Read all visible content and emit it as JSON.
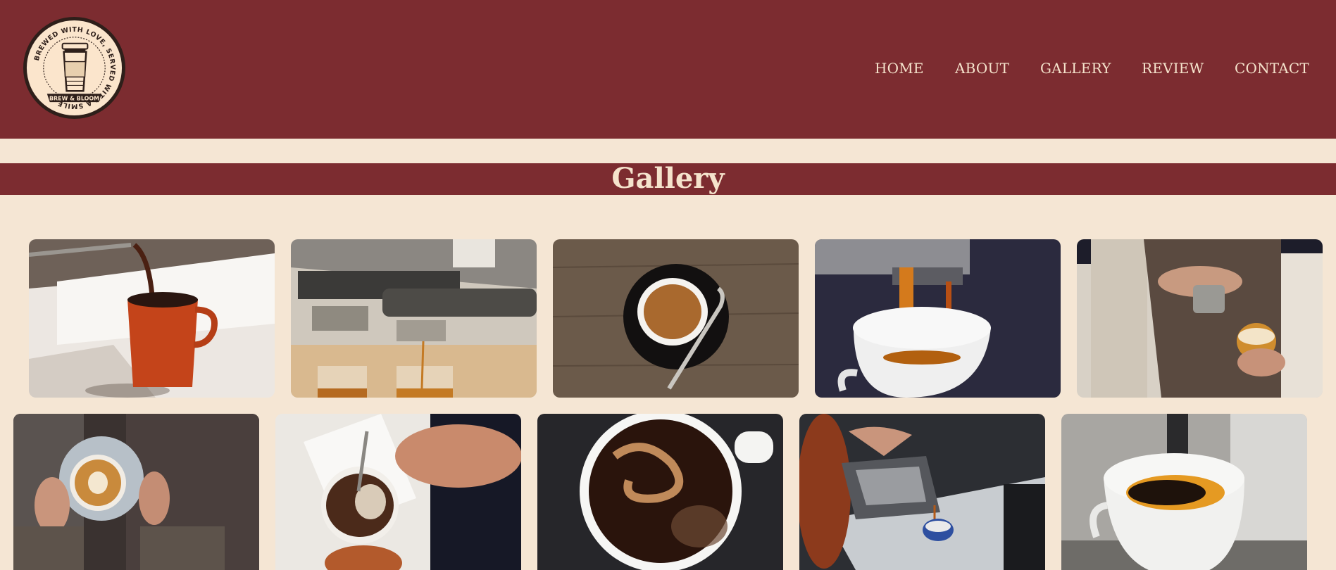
{
  "header": {
    "logo": {
      "ring_text": "BREWED WITH LOVE, SERVED WITH A SMILE",
      "banner_text": "BREW & BLOOM",
      "icon": "coffee-cup-icon"
    },
    "nav": [
      "HOME",
      "ABOUT",
      "GALLERY",
      "REVIEW",
      "CONTACT"
    ]
  },
  "page_title": "Gallery",
  "gallery": {
    "row1": [
      "coffee-pour-orange-mug",
      "espresso-machine-double-shot",
      "espresso-cup-on-wooden-table",
      "espresso-dripping-white-cup",
      "barista-latte-art-pour"
    ],
    "row2": [
      "hands-holding-latte",
      "pour-over-filter-brew",
      "black-coffee-swirl-top-view",
      "french-press-pour-small-cup",
      "espresso-shot-into-cup"
    ]
  },
  "colors": {
    "brand": "#7c2c30",
    "background": "#f5e6d4",
    "nav_text": "#f5e3cc"
  }
}
